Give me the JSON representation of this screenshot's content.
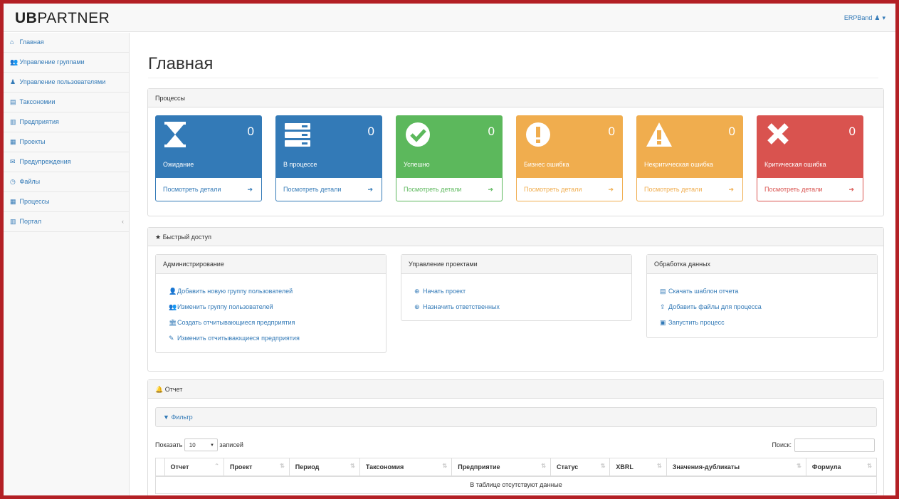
{
  "app": {
    "logo_bold": "UB",
    "logo_rest": "PARTNER",
    "user": "ERPBand"
  },
  "sidebar": {
    "items": [
      {
        "icon": "⌂",
        "label": "Главная"
      },
      {
        "icon": "👥",
        "label": "Управление группами"
      },
      {
        "icon": "♟",
        "label": "Управление пользователями"
      },
      {
        "icon": "▤",
        "label": "Таксономии"
      },
      {
        "icon": "▥",
        "label": "Предприятия"
      },
      {
        "icon": "▦",
        "label": "Проекты"
      },
      {
        "icon": "✉",
        "label": "Предупреждения"
      },
      {
        "icon": "◷",
        "label": "Файлы"
      },
      {
        "icon": "▦",
        "label": "Процессы"
      },
      {
        "icon": "▥",
        "label": "Портал"
      }
    ],
    "collapse": "‹"
  },
  "main": {
    "title": "Главная",
    "processes": {
      "heading": "Процессы",
      "tiles": [
        {
          "label": "Ожидание",
          "count": "0",
          "link": "Посмотреть детали",
          "color": "#337ab7"
        },
        {
          "label": "В процессе",
          "count": "0",
          "link": "Посмотреть детали",
          "color": "#337ab7"
        },
        {
          "label": "Успешно",
          "count": "0",
          "link": "Посмотреть детали",
          "color": "#5cb85c"
        },
        {
          "label": "Бизнес ошибка",
          "count": "0",
          "link": "Посмотреть детали",
          "color": "#f0ad4e"
        },
        {
          "label": "Некритическая ошибка",
          "count": "0",
          "link": "Посмотреть детали",
          "color": "#f0ad4e"
        },
        {
          "label": "Критическая ошибка",
          "count": "0",
          "link": "Посмотреть детали",
          "color": "#d9534f"
        }
      ]
    },
    "quick": {
      "heading": "Быстрый доступ",
      "admin": {
        "heading": "Администрирование",
        "links": [
          {
            "icon": "👤",
            "label": "Добавить новую группу пользователей"
          },
          {
            "icon": "👥",
            "label": "Изменить группу пользователей"
          },
          {
            "icon": "🏛",
            "label": "Создать отчитывающиеся предприятия"
          },
          {
            "icon": "✎",
            "label": "Изменить отчитывающиеся предприятия"
          }
        ]
      },
      "projects": {
        "heading": "Управление проектами",
        "links": [
          {
            "icon": "⊕",
            "label": "Начать проект"
          },
          {
            "icon": "⊕",
            "label": "Назначить ответственных"
          }
        ]
      },
      "data": {
        "heading": "Обработка данных",
        "links": [
          {
            "icon": "▤",
            "label": "Скачать шаблон отчета"
          },
          {
            "icon": "⇪",
            "label": "Добавить файлы для процесса"
          },
          {
            "icon": "▣",
            "label": "Запустить процесс"
          }
        ]
      }
    },
    "report": {
      "heading": "Отчет",
      "filter": "Фильтр",
      "show_label": "Показать",
      "page_size": "10",
      "records_label": "записей",
      "search_label": "Поиск:",
      "columns": [
        "Отчет",
        "Проект",
        "Период",
        "Таксономия",
        "Предприятие",
        "Статус",
        "XBRL",
        "Значения-дубликаты",
        "Формула"
      ],
      "empty": "В таблице отсутствуют данные"
    }
  }
}
